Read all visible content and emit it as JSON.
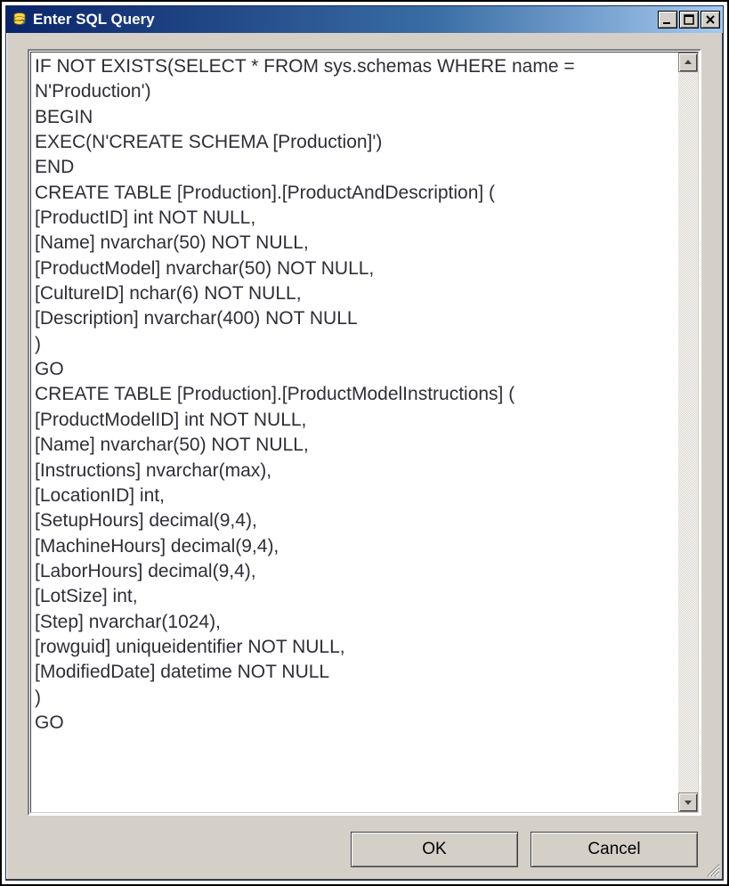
{
  "window": {
    "title": "Enter SQL Query"
  },
  "editor": {
    "sql": "IF NOT EXISTS(SELECT * FROM sys.schemas WHERE name = N'Production')\nBEGIN\nEXEC(N'CREATE SCHEMA [Production]')\nEND\nCREATE TABLE [Production].[ProductAndDescription] (\n[ProductID] int NOT NULL,\n[Name] nvarchar(50) NOT NULL,\n[ProductModel] nvarchar(50) NOT NULL,\n[CultureID] nchar(6) NOT NULL,\n[Description] nvarchar(400) NOT NULL\n)\nGO\nCREATE TABLE [Production].[ProductModelInstructions] (\n[ProductModelID] int NOT NULL,\n[Name] nvarchar(50) NOT NULL,\n[Instructions] nvarchar(max),\n[LocationID] int,\n[SetupHours] decimal(9,4),\n[MachineHours] decimal(9,4),\n[LaborHours] decimal(9,4),\n[LotSize] int,\n[Step] nvarchar(1024),\n[rowguid] uniqueidentifier NOT NULL,\n[ModifiedDate] datetime NOT NULL\n)\nGO\n"
  },
  "buttons": {
    "ok": "OK",
    "cancel": "Cancel"
  },
  "icons": {
    "app": "database-icon",
    "minimize": "minimize-icon",
    "maximize": "maximize-icon",
    "close": "close-icon",
    "scroll_up": "scroll-up-icon",
    "scroll_down": "scroll-down-icon",
    "resize": "resize-grip-icon"
  }
}
